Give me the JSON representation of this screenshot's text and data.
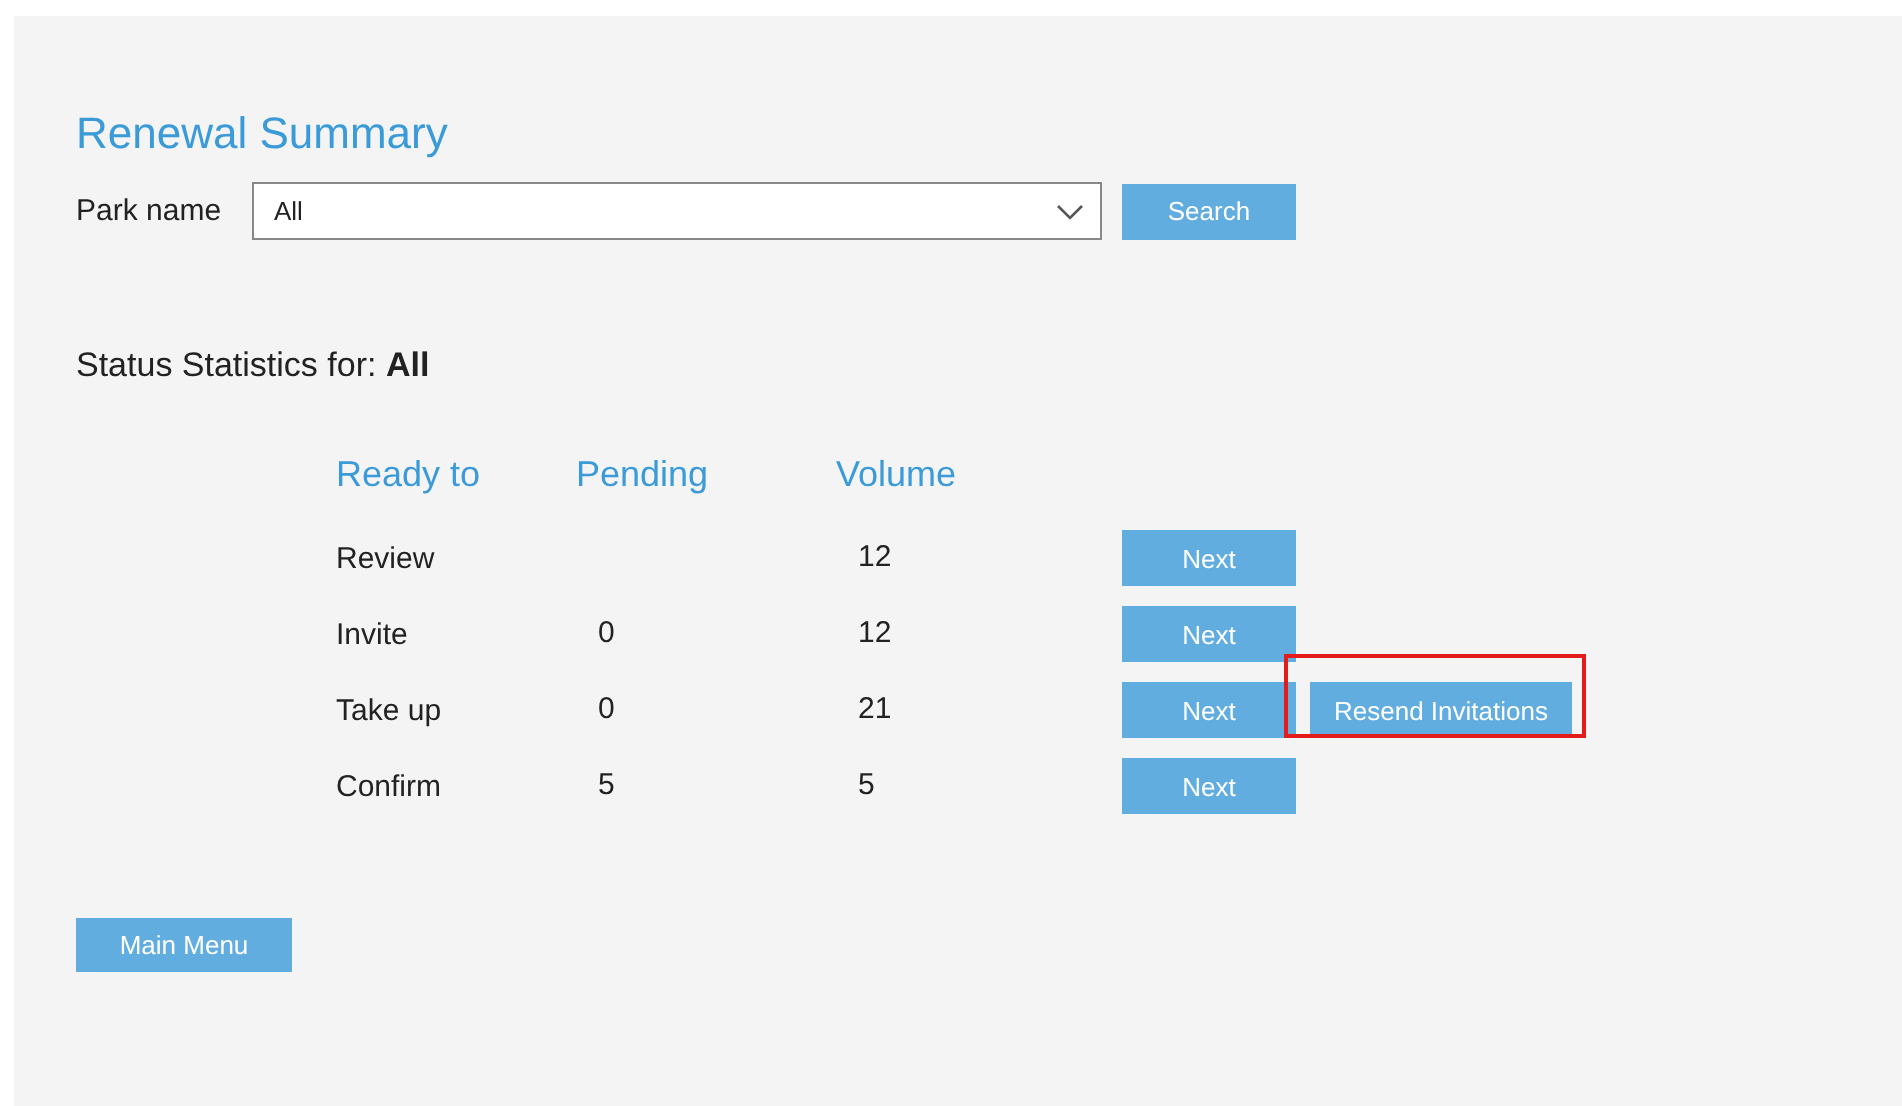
{
  "title": "Renewal Summary",
  "filter": {
    "label": "Park name",
    "value": "All",
    "button": "Search"
  },
  "status": {
    "prefix": "Status Statistics for: ",
    "value": "All"
  },
  "table": {
    "columns": [
      "Ready to",
      "Pending",
      "Volume"
    ],
    "rows": [
      {
        "stage": "Review",
        "volume": "12",
        "button": "Next"
      },
      {
        "stage": "Invite",
        "pending": "0",
        "volume": "12",
        "button": "Next"
      },
      {
        "stage": "Take up",
        "pending": "0",
        "volume": "21",
        "button": "Next",
        "extra_button": {
          "label": "Resend Invitations",
          "highlighted": true
        }
      },
      {
        "stage": "Confirm",
        "pending": "5",
        "volume": "5",
        "button": "Next"
      }
    ]
  },
  "main_menu": "Main Menu"
}
